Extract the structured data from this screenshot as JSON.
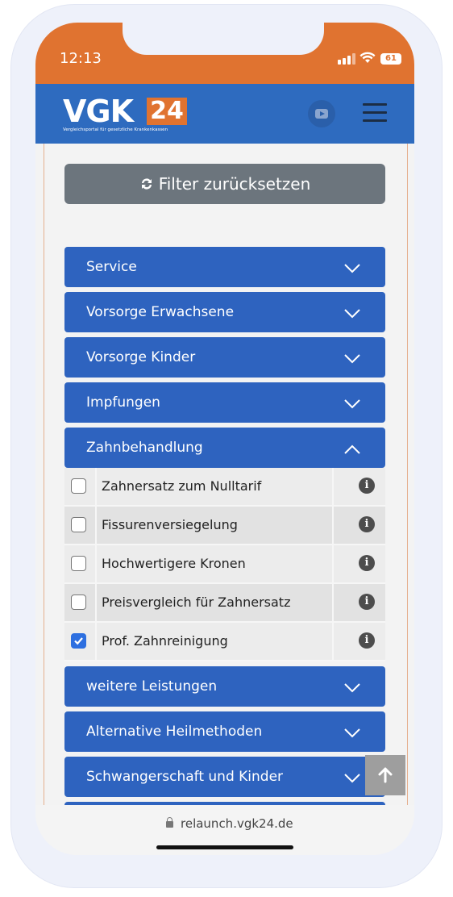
{
  "status_bar": {
    "time": "12:13",
    "battery": "61"
  },
  "header": {
    "logo_main": "VGK",
    "logo_number": "24",
    "logo_tagline": "Vergleichsportal für gesetzliche Krankenkassen"
  },
  "filter": {
    "reset_label": "Filter zurücksetzen"
  },
  "accordion": [
    {
      "label": "Service",
      "expanded": false
    },
    {
      "label": "Vorsorge Erwachsene",
      "expanded": false
    },
    {
      "label": "Vorsorge Kinder",
      "expanded": false
    },
    {
      "label": "Impfungen",
      "expanded": false
    },
    {
      "label": "Zahnbehandlung",
      "expanded": true
    },
    {
      "label": "weitere Leistungen",
      "expanded": false
    },
    {
      "label": "Alternative Heilmethoden",
      "expanded": false
    },
    {
      "label": "Schwangerschaft und Kinder",
      "expanded": false
    }
  ],
  "zahn_options": [
    {
      "label": "Zahnersatz zum Nulltarif",
      "checked": false
    },
    {
      "label": "Fissurenversiegelung",
      "checked": false
    },
    {
      "label": "Hochwertigere Kronen",
      "checked": false
    },
    {
      "label": "Preisvergleich für Zahnersatz",
      "checked": false
    },
    {
      "label": "Prof. Zahnreinigung",
      "checked": true
    }
  ],
  "browser": {
    "url": "relaunch.vgk24.de"
  },
  "colors": {
    "header_blue": "#2e6bbf",
    "accent_orange": "#e07330",
    "accordion_blue": "#2e63bf",
    "reset_gray": "#6c757d"
  }
}
